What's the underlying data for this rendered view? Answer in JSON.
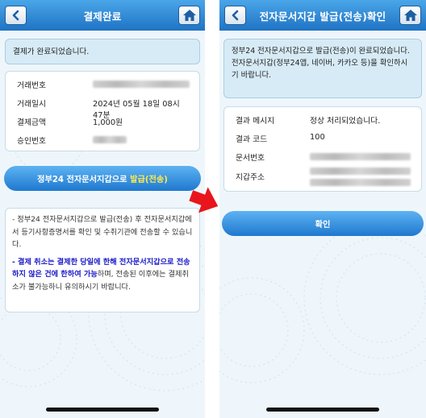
{
  "left": {
    "header": {
      "title": "결제완료"
    },
    "message": "결제가 완료되었습니다.",
    "details": [
      {
        "label": "거래번호",
        "value": ""
      },
      {
        "label": "거래일시",
        "value": "2024년 05월 18일 08시 47분"
      },
      {
        "label": "결제금액",
        "value": "1,000원"
      },
      {
        "label": "승인번호",
        "value": ""
      }
    ],
    "issue_button": {
      "prefix": "정부24 전자문서지갑으로 ",
      "highlight": "발급(전송)"
    },
    "notice": {
      "para1": "- 정부24 전자문서지갑으로 발급(전송) 후 전자문서지갑에서 등기사항증명서를 확인 및 수취기관에 전송할 수 있습니다.",
      "para2_strong": "- 결제 취소는 결제한 당일에 한해 전자문서지갑으로 전송하지 않은 건에 한하여 가능",
      "para2_rest": "하며, 전송된 이후에는 결제취소가 불가능하니 유의하시기 바랍니다."
    }
  },
  "right": {
    "header": {
      "title": "전자문서지갑 발급(전송)확인"
    },
    "message_line1": "정부24 전자문서지갑으로 발급(전송)이 완료되었습니다.",
    "message_line2": "전자문서지갑(정부24앱, 네이버, 카카오 등)을 확인하시기 바랍니다.",
    "details": [
      {
        "label": "결과 메시지",
        "value": "정상 처리되었습니다."
      },
      {
        "label": "결과 코드",
        "value": "100"
      },
      {
        "label": "문서번호",
        "value": ""
      },
      {
        "label": "지갑주소",
        "value": ""
      }
    ],
    "confirm_button": "확인"
  },
  "icons": {
    "back": "back-arrow-icon",
    "home": "home-icon",
    "annotation": "red-arrow-icon"
  },
  "colors": {
    "header": "#2b86d4",
    "button": "#2a83d6",
    "highlight": "#ffe94a",
    "annotation": "#e8161c",
    "warning_text": "#1c1cc8"
  }
}
